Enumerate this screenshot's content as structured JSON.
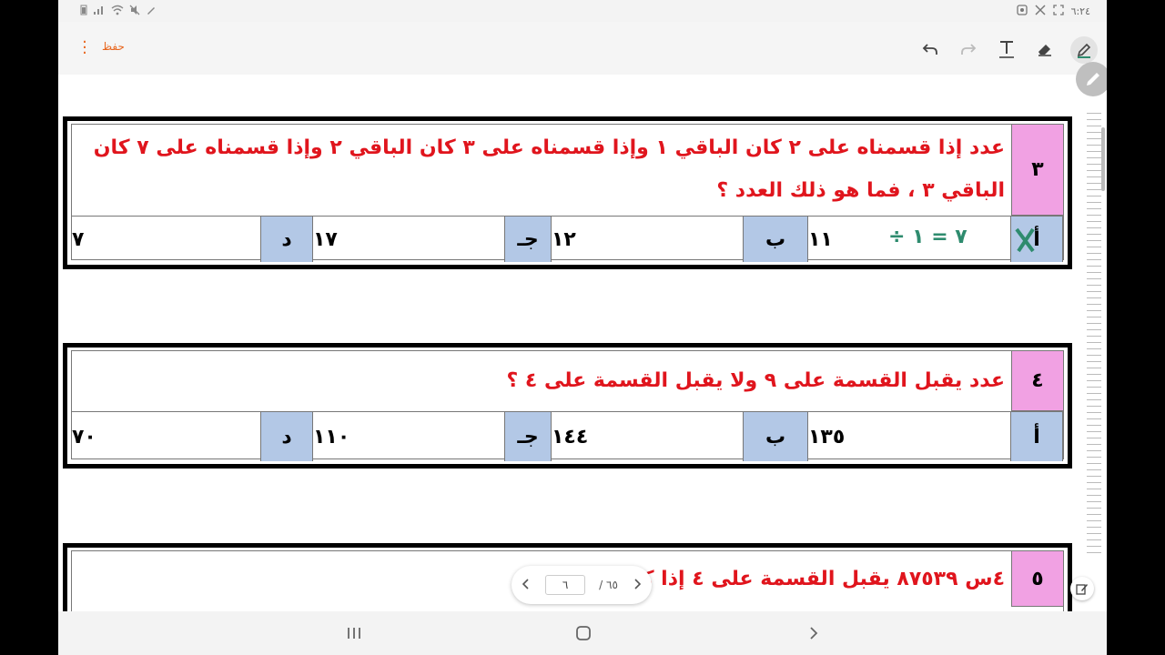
{
  "status_bar": {
    "time": "٦:٢٤"
  },
  "toolbar": {
    "save_label": "حفظ",
    "menu_icon": "more-vert-icon",
    "tools": [
      "undo-icon",
      "redo-icon",
      "text-icon",
      "eraser-icon",
      "pen-icon"
    ]
  },
  "questions": [
    {
      "number": "٣",
      "text_line1": "عدد إذا قسمناه على ٢ كان الباقي ١ وإذا قسمناه على ٣ كان الباقي ٢ وإذا قسمناه على ٧ كان",
      "text_line2": "الباقي ٣ ، فما هو ذلك العدد ؟",
      "options": [
        {
          "label": "أ",
          "value": "١١"
        },
        {
          "label": "ب",
          "value": "١٢"
        },
        {
          "label": "جـ",
          "value": "١٧"
        },
        {
          "label": "د",
          "value": "٧"
        }
      ],
      "annotation": "÷ ٧ = ١"
    },
    {
      "number": "٤",
      "text_line1": "عدد يقبل القسمة على ٩ ولا يقبل القسمة على ٤ ؟",
      "options": [
        {
          "label": "أ",
          "value": "١٣٥"
        },
        {
          "label": "ب",
          "value": "١٤٤"
        },
        {
          "label": "جـ",
          "value": "١١٠"
        },
        {
          "label": "د",
          "value": "٧٠"
        }
      ]
    },
    {
      "number": "٥",
      "text_line1": "٤س ٨٧٥٣٩  يقبل القسمة على ٤ إذا كـ"
    }
  ],
  "pager": {
    "current": "٦",
    "total": "/ ٦٥"
  },
  "colors": {
    "question_text": "#e0151d",
    "number_cell": "#f1a1e3",
    "option_label_cell": "#b3c8e6",
    "accent": "#e8661e",
    "annotation": "#2e8b6e"
  }
}
